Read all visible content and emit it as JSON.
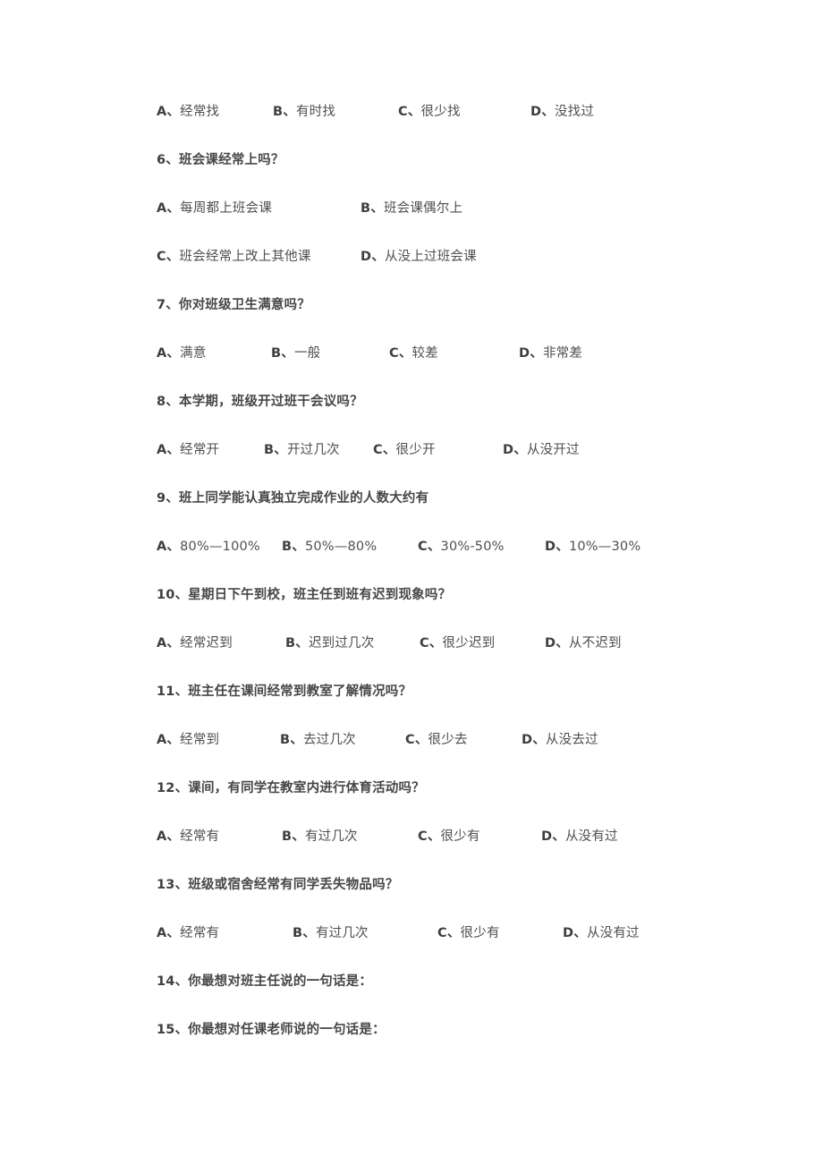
{
  "document": {
    "background_color": "#ffffff",
    "text_color": "#4a4a4a",
    "blocks": [
      {
        "kind": "options",
        "belongs_to": "5",
        "col_variant": "cols-a",
        "rows": [
          [
            {
              "label": "A、",
              "text": "经常找"
            },
            {
              "label": "B、",
              "text": "有时找"
            },
            {
              "label": "C、",
              "text": "很少找"
            },
            {
              "label": "D、",
              "text": "没找过"
            }
          ]
        ]
      },
      {
        "kind": "question",
        "number": "6、",
        "text": "班会课经常上吗？"
      },
      {
        "kind": "options",
        "belongs_to": "6",
        "col_variant": "cols-b",
        "rows": [
          [
            {
              "label": "A、",
              "text": "每周都上班会课"
            },
            {
              "label": "B、",
              "text": "班会课偶尔上"
            }
          ],
          [
            {
              "label": "C、",
              "text": "班会经常上改上其他课"
            },
            {
              "label": "D、",
              "text": "从没上过班会课"
            }
          ]
        ]
      },
      {
        "kind": "question",
        "number": "7、",
        "text": "你对班级卫生满意吗？"
      },
      {
        "kind": "options",
        "belongs_to": "7",
        "col_variant": "cols-c",
        "rows": [
          [
            {
              "label": "A、",
              "text": "满意"
            },
            {
              "label": "B、",
              "text": "一般"
            },
            {
              "label": "C、",
              "text": "较差"
            },
            {
              "label": "D、",
              "text": "非常差"
            }
          ]
        ]
      },
      {
        "kind": "question",
        "number": "8、",
        "text": "本学期，班级开过班干会议吗？"
      },
      {
        "kind": "options",
        "belongs_to": "8",
        "col_variant": "cols-d",
        "rows": [
          [
            {
              "label": "A、",
              "text": "经常开"
            },
            {
              "label": "B、",
              "text": "开过几次"
            },
            {
              "label": "C、",
              "text": "很少开"
            },
            {
              "label": "D、",
              "text": "从没开过"
            }
          ]
        ]
      },
      {
        "kind": "question",
        "number": "9、",
        "text": "班上同学能认真独立完成作业的人数大约有"
      },
      {
        "kind": "options",
        "belongs_to": "9",
        "col_variant": "cols-e",
        "rows": [
          [
            {
              "label": "A、",
              "text": "80%—100%"
            },
            {
              "label": "B、",
              "text": "50%—80%"
            },
            {
              "label": "C、",
              "text": "30%-50%"
            },
            {
              "label": "D、",
              "text": "10%—30%"
            }
          ]
        ]
      },
      {
        "kind": "question",
        "number": "10、",
        "text": "星期日下午到校，班主任到班有迟到现象吗？"
      },
      {
        "kind": "options",
        "belongs_to": "10",
        "col_variant": "cols-f",
        "rows": [
          [
            {
              "label": "A、",
              "text": "经常迟到"
            },
            {
              "label": "B、",
              "text": "迟到过几次"
            },
            {
              "label": "C、",
              "text": "很少迟到"
            },
            {
              "label": "D、",
              "text": "从不迟到"
            }
          ]
        ]
      },
      {
        "kind": "question",
        "number": "11、",
        "text": "班主任在课间经常到教室了解情况吗？"
      },
      {
        "kind": "options",
        "belongs_to": "11",
        "col_variant": "cols-g",
        "rows": [
          [
            {
              "label": "A、",
              "text": "经常到"
            },
            {
              "label": "B、",
              "text": "去过几次"
            },
            {
              "label": "C、",
              "text": "很少去"
            },
            {
              "label": "D、",
              "text": "从没去过"
            }
          ]
        ]
      },
      {
        "kind": "question",
        "number": "12、",
        "text": "课间，有同学在教室内进行体育活动吗？"
      },
      {
        "kind": "options",
        "belongs_to": "12",
        "col_variant": "cols-h",
        "rows": [
          [
            {
              "label": "A、",
              "text": "经常有"
            },
            {
              "label": "B、",
              "text": "有过几次"
            },
            {
              "label": "C、",
              "text": "很少有"
            },
            {
              "label": "D、",
              "text": "从没有过"
            }
          ]
        ]
      },
      {
        "kind": "question",
        "number": "13、",
        "text": "班级或宿舍经常有同学丢失物品吗？"
      },
      {
        "kind": "options",
        "belongs_to": "13",
        "col_variant": "cols-i",
        "rows": [
          [
            {
              "label": "A、",
              "text": "经常有"
            },
            {
              "label": "B、",
              "text": "有过几次"
            },
            {
              "label": "C、",
              "text": "很少有"
            },
            {
              "label": "D、",
              "text": "从没有过"
            }
          ]
        ]
      },
      {
        "kind": "question",
        "number": "14、",
        "text": "你最想对班主任说的一句话是："
      },
      {
        "kind": "question",
        "number": "15、",
        "text": "你最想对任课老师说的一句话是："
      }
    ]
  }
}
